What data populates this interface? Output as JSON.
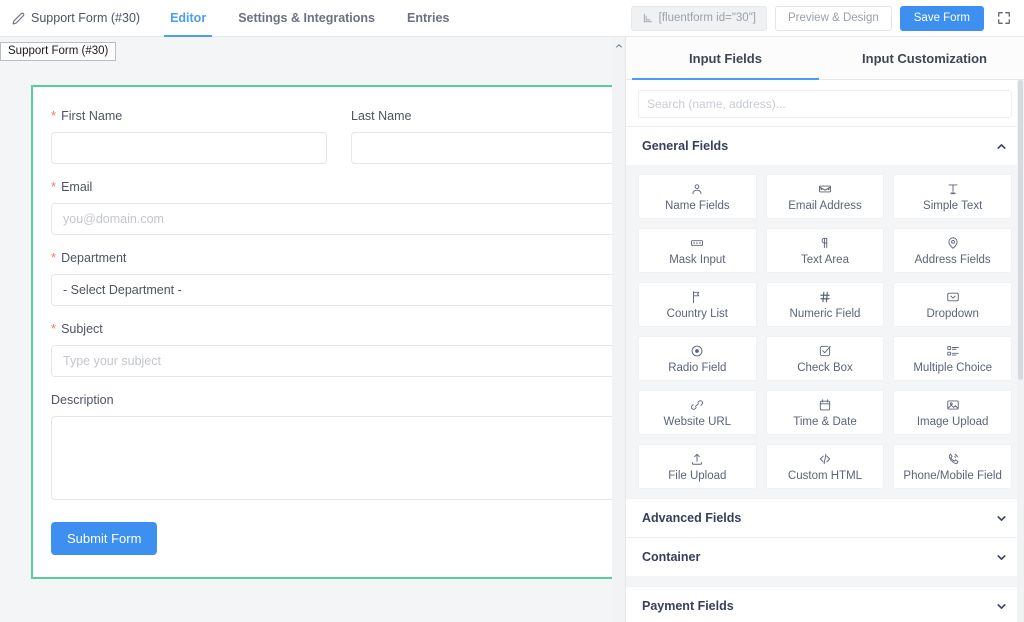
{
  "topbar": {
    "form_name": "Support Form (#30)",
    "pencil_icon": "pencil-icon",
    "tabs": [
      {
        "label": "Editor",
        "active": true
      },
      {
        "label": "Settings & Integrations",
        "active": false
      },
      {
        "label": "Entries",
        "active": false
      }
    ],
    "shortcode": "[fluentform id=\"30\"]",
    "shortcode_icon": "shortcode-icon",
    "preview_label": "Preview & Design",
    "save_label": "Save Form",
    "fullscreen_icon": "fullscreen-icon",
    "accent_blue": "#3e90f0"
  },
  "status_tooltip": {
    "text": "Support Form (#30)"
  },
  "canvas": {
    "highlight_color": "#56cf9b",
    "fields": [
      {
        "name": "first_name",
        "label": "First Name",
        "required": true,
        "placeholder": "",
        "value": "",
        "type": "text",
        "half": true
      },
      {
        "name": "last_name",
        "label": "Last Name",
        "required": false,
        "placeholder": "",
        "value": "",
        "type": "text",
        "half": true
      },
      {
        "name": "email",
        "label": "Email",
        "required": true,
        "placeholder": "you@domain.com",
        "value": "",
        "type": "email"
      },
      {
        "name": "department",
        "label": "Department",
        "required": true,
        "selected": "- Select Department -",
        "type": "select"
      },
      {
        "name": "subject",
        "label": "Subject",
        "required": true,
        "placeholder": "Type your subject",
        "value": "",
        "type": "text"
      },
      {
        "name": "description",
        "label": "Description",
        "required": false,
        "placeholder": "",
        "value": "",
        "type": "textarea"
      }
    ],
    "submit_label": "Submit Form",
    "required_marker": "*"
  },
  "panel": {
    "tabs": [
      {
        "label": "Input Fields",
        "active": true
      },
      {
        "label": "Input Customization",
        "active": false
      }
    ],
    "search_placeholder": "Search (name, address)...",
    "search_value": "",
    "sections": [
      {
        "title": "General Fields",
        "expanded": true,
        "items": [
          {
            "label": "Name Fields",
            "icon": "user-icon"
          },
          {
            "label": "Email Address",
            "icon": "envelope-icon"
          },
          {
            "label": "Simple Text",
            "icon": "text-cursor-icon"
          },
          {
            "label": "Mask Input",
            "icon": "mask-input-icon"
          },
          {
            "label": "Text Area",
            "icon": "paragraph-icon"
          },
          {
            "label": "Address Fields",
            "icon": "map-pin-icon"
          },
          {
            "label": "Country List",
            "icon": "flag-icon"
          },
          {
            "label": "Numeric Field",
            "icon": "hash-icon"
          },
          {
            "label": "Dropdown",
            "icon": "dropdown-icon"
          },
          {
            "label": "Radio Field",
            "icon": "radio-icon"
          },
          {
            "label": "Check Box",
            "icon": "checkbox-icon"
          },
          {
            "label": "Multiple Choice",
            "icon": "list-icon"
          },
          {
            "label": "Website URL",
            "icon": "link-icon"
          },
          {
            "label": "Time & Date",
            "icon": "calendar-icon"
          },
          {
            "label": "Image Upload",
            "icon": "image-icon"
          },
          {
            "label": "File Upload",
            "icon": "upload-icon"
          },
          {
            "label": "Custom HTML",
            "icon": "code-icon"
          },
          {
            "label": "Phone/Mobile Field",
            "icon": "phone-icon"
          }
        ]
      },
      {
        "title": "Advanced Fields",
        "expanded": false,
        "items": []
      },
      {
        "title": "Container",
        "expanded": false,
        "items": []
      },
      {
        "title": "Payment Fields",
        "expanded": false,
        "items": []
      }
    ]
  }
}
